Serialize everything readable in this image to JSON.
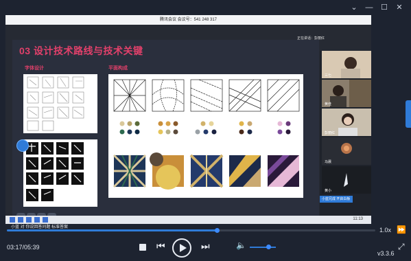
{
  "window": {
    "minimize": "⌄",
    "minimize2": "—",
    "maximize": "☐",
    "close": "✕"
  },
  "meeting": {
    "title_bar": "腾讯会议  会议号：541 248 317",
    "share_label": "正在讲话：彭丽红"
  },
  "slide": {
    "title": "03  设计技术路线与技术关键",
    "section_type": "字体设计",
    "section_plane": "平面构成"
  },
  "participants": [
    {
      "name": "三七"
    },
    {
      "name": "黄佳"
    },
    {
      "name": "彭丽红"
    },
    {
      "name": "马晨"
    },
    {
      "name": "黄小"
    }
  ],
  "recording_overlay": {
    "user_tag": "小蓝兄成  开启白板",
    "note": "小蓝 对 你说回答问题 标准答案"
  },
  "taskbar": {
    "time": "11:13"
  },
  "player": {
    "progress": 0.57,
    "speed": "1.0x",
    "current_time": "03:17",
    "total_time": "05:39",
    "time_display": "03:17/05:39",
    "volume": 0.7,
    "version": "v3.3.6"
  },
  "colors": {
    "accent": "#2f7bd8",
    "title_red": "#e0406a"
  }
}
